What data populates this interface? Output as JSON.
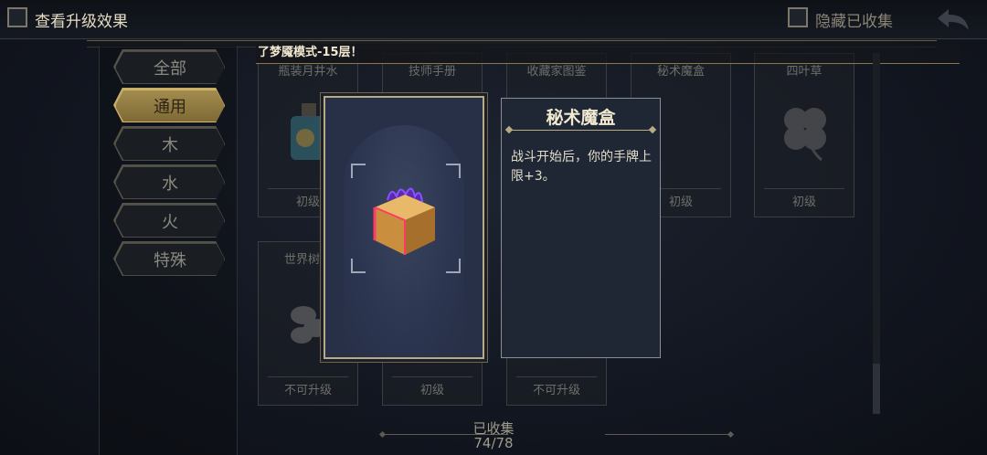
{
  "topbar": {
    "view_upgrade_label": "查看升级效果",
    "hide_collected_label": "隐藏已收集",
    "back_icon": "back-arrow-icon"
  },
  "notice": {
    "text": "了梦魇模式-15层！"
  },
  "categories": [
    {
      "label": "全部",
      "active": false
    },
    {
      "label": "通用",
      "active": true
    },
    {
      "label": "木",
      "active": false
    },
    {
      "label": "水",
      "active": false
    },
    {
      "label": "火",
      "active": false
    },
    {
      "label": "特殊",
      "active": false
    }
  ],
  "cards": [
    {
      "title": "瓶装月井水",
      "level": "初级",
      "icon": "potion-icon"
    },
    {
      "title": "技师手册",
      "level": "",
      "icon": "book-icon"
    },
    {
      "title": "收藏家图鉴",
      "level": "",
      "icon": "album-icon"
    },
    {
      "title": "秘术魔盒",
      "level": "初级",
      "icon": "magic-box-icon"
    },
    {
      "title": "四叶草",
      "level": "初级",
      "icon": "clover-icon"
    },
    {
      "title": "世界树之",
      "level": "不可升级",
      "icon": "leaf-icon"
    },
    {
      "title": "",
      "level": "初级",
      "icon": ""
    },
    {
      "title": "",
      "level": "不可升级",
      "icon": ""
    }
  ],
  "detail": {
    "title": "秘术魔盒",
    "description": "战斗开始后，你的手牌上限+3。",
    "icon": "magic-box-icon"
  },
  "footer": {
    "collected_label": "已收集",
    "collected_count": "74/78"
  },
  "colors": {
    "gold": "#b9aa86",
    "active_tab": "#a28b4e",
    "panel": "#273046"
  }
}
